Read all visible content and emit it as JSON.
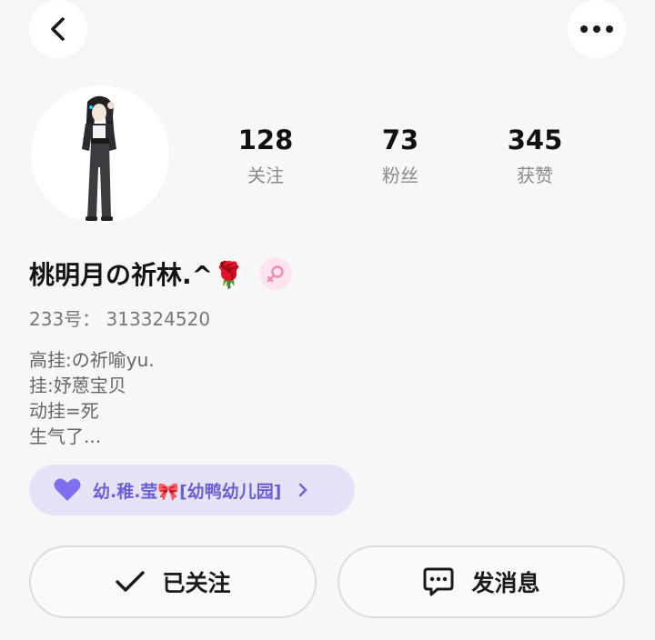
{
  "header": {
    "back_icon": "back-arrow-icon",
    "more_icon": "more-dots-icon"
  },
  "profile": {
    "avatar_desc": "anime-character-avatar",
    "username": "桃明月の祈林.^🌹",
    "gender_icon": "female-icon",
    "uid_text": "233号： 313324520",
    "bio_lines": [
      "高挂:の祈喻yu.",
      "挂:妤蒽宝贝",
      "动挂=死",
      "生气了..."
    ]
  },
  "stats": [
    {
      "value": "128",
      "label": "关注"
    },
    {
      "value": "73",
      "label": "粉丝"
    },
    {
      "value": "345",
      "label": "获赞"
    }
  ],
  "group": {
    "icon": "purple-heart-icon",
    "name": "幼.稚.莹🎀[幼鸭幼儿园]"
  },
  "actions": {
    "follow_label": "已关注",
    "message_label": "发消息"
  },
  "colors": {
    "background": "#f7f7f7",
    "group_pill_bg": "#e6e3f8",
    "group_text": "#6b5fd6",
    "gender_badge_bg": "#fde4ee",
    "gender_icon": "#f08bb3"
  }
}
